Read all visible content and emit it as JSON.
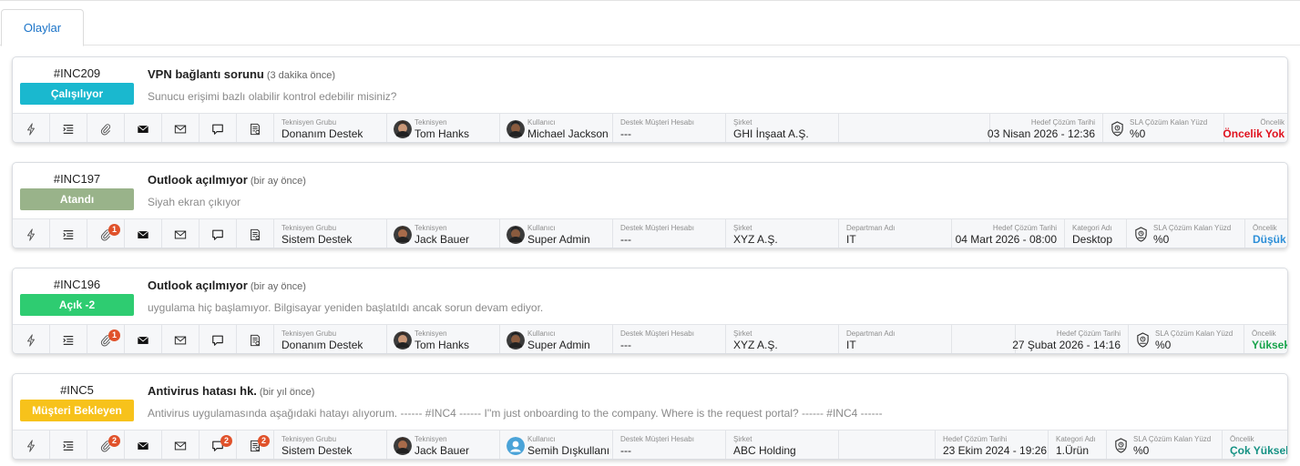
{
  "tabs": [
    {
      "label": "Olaylar"
    }
  ],
  "labels": {
    "group": "Teknisyen Grubu",
    "tech": "Teknisyen",
    "user": "Kullanıcı",
    "account": "Destek Müşteri Hesabı",
    "company": "Şirket",
    "dept": "Departman Adı",
    "target": "Hedef Çözüm Tarihi",
    "category": "Kategori Adı",
    "sla": "SLA Çözüm Kalan Yüzd",
    "priority": "Öncelik"
  },
  "colors": {
    "calisiyor": "#1ab8cf",
    "atandi": "#99b38a",
    "acik": "#2ecc71",
    "musteri_bekleyen": "#f7c21b",
    "oncelik_yok": "#e0121e",
    "dusuk": "#2d8fd8",
    "yuksek": "#16a34a",
    "cok_yuksek": "#149183",
    "badge": "#e0522b"
  },
  "icons": [
    "lightning-icon",
    "list-icon",
    "paperclip-icon",
    "envelope-filled-icon",
    "envelope-outline-icon",
    "chat-icon",
    "survey-icon"
  ],
  "incidents": [
    {
      "id": "#INC209",
      "status": "Çalışılıyor",
      "title": "VPN bağlantı sorunu",
      "ago": "(3 dakika önce)",
      "description": "Sunucu erişimi bazlı olabilir kontrol edebilir misiniz?",
      "badges": {
        "attach": "",
        "chat": "",
        "survey": ""
      },
      "group": "Donanım Destek",
      "technician": "Tom Hanks",
      "user": "Michael Jackson",
      "account": "---",
      "company": "GHI İnşaat A.Ş.",
      "department": "",
      "target_date": "03 Nisan 2026 - 12:36",
      "category": "",
      "sla": "%0",
      "priority": "Öncelik Yok"
    },
    {
      "id": "#INC197",
      "status": "Atandı",
      "title": "Outlook açılmıyor",
      "ago": "(bir ay önce)",
      "description": "Siyah ekran çıkıyor",
      "badges": {
        "attach": "1",
        "chat": "",
        "survey": ""
      },
      "group": "Sistem Destek",
      "technician": "Jack Bauer",
      "user": "Super Admin",
      "account": "---",
      "company": "XYZ A.Ş.",
      "department": "IT",
      "target_date": "04 Mart 2026 - 08:00",
      "category": "Desktop",
      "sla": "%0",
      "priority": "Düşük"
    },
    {
      "id": "#INC196",
      "status": "Açık -2",
      "title": "Outlook açılmıyor",
      "ago": "(bir ay önce)",
      "description": "uygulama hiç başlamıyor. Bilgisayar yeniden başlatıldı ancak sorun devam ediyor.",
      "badges": {
        "attach": "1",
        "chat": "",
        "survey": ""
      },
      "group": "Donanım Destek",
      "technician": "Tom Hanks",
      "user": "Super Admin",
      "account": "---",
      "company": "XYZ A.Ş.",
      "department": "IT",
      "target_date": "27 Şubat 2026 - 14:16",
      "category": "",
      "sla": "%0",
      "priority": "Yüksek"
    },
    {
      "id": "#INC5",
      "status": "Müşteri Bekleyen",
      "title": "Antivirus hatası hk.",
      "ago": "(bir yıl önce)",
      "description": "Antivirus uygulamasında aşağıdaki hatayı alıyorum. ------ #INC4 ------ I''m just onboarding to the company. Where is the request portal? ------ #INC4 ------",
      "badges": {
        "attach": "2",
        "chat": "2",
        "survey": "2"
      },
      "group": "Sistem Destek",
      "technician": "Jack Bauer",
      "user": "Semih Dışkullanı",
      "account": "---",
      "company": "ABC Holding",
      "department": "",
      "target_date": "23 Ekim 2024 - 19:26",
      "category": "1.Ürün",
      "sla": "%0",
      "priority": "Çok Yüksek"
    }
  ]
}
